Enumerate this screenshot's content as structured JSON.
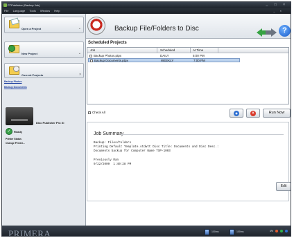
{
  "window": {
    "title": "PTPublisher (Backup Job)",
    "controls": "_ □ ×"
  },
  "menu": {
    "items": [
      "File",
      "Language",
      "Tools",
      "Window",
      "Help"
    ],
    "controls": "_ ×"
  },
  "sidebar": {
    "open_project": "Open a Project",
    "new_project": "New Project",
    "current_projects": "Current Projects",
    "projects": [
      "Backup Photos",
      "Backup Documents"
    ],
    "printer_name": "Disc Publisher Pro Xi",
    "status": "Ready",
    "links": [
      "Printer Status",
      "Change Printer..."
    ]
  },
  "header": {
    "title": "Backup File/Folders to Disc"
  },
  "scheduled": {
    "label": "Scheduled Projects",
    "columns": [
      "Job",
      "Scheduled",
      "At Time"
    ],
    "rows": [
      {
        "job": "Backup Photos.ptpx",
        "scheduled": "DAILY",
        "time": "5:00 PM"
      },
      {
        "job": "Backup Documents.ptpx",
        "scheduled": "WEEKLY",
        "time": "7:00 PM"
      }
    ],
    "check_all": "Check All",
    "run_now": "Run Now"
  },
  "summary": {
    "title": "Job Summary",
    "lines": [
      "Backup: Files/Folders",
      "Printing Default Template.stdwtt Disc Title: Documents and Disc Desc.:",
      "Documents backup for Computer Name TSP-1003"
    ],
    "prev_label": "Previously Ran",
    "prev_value": "9/22/2009  1:40:28 PM",
    "edit": "Edit"
  },
  "statusbar": {
    "brand": "PRIMERA",
    "ink1": "100ms",
    "ink2": "100ms",
    "tray": "4%"
  },
  "colors": {
    "accent_green": "#36a343",
    "help_blue": "#1559c9",
    "selection": "#bcd3ee"
  }
}
